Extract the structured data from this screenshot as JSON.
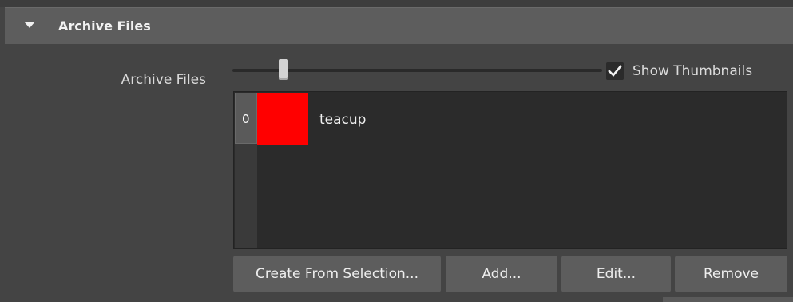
{
  "section": {
    "title": "Archive Files",
    "expanded": true,
    "arrow_icon": "triangle-down-icon"
  },
  "archive_files_row": {
    "label": "Archive Files",
    "thumbnail_size_slider": {
      "value_fraction": 0.13
    },
    "show_thumbnails": {
      "label": "Show Thumbnails",
      "checked": true,
      "icon": "checkmark-icon"
    },
    "list": {
      "items": [
        {
          "index": "0",
          "name": "teacup",
          "thumbnail_color": "#ff0000"
        }
      ]
    }
  },
  "buttons": {
    "create_from_selection": "Create From Selection...",
    "add": "Add...",
    "edit": "Edit...",
    "remove": "Remove"
  },
  "colors": {
    "panel_bg": "#444444",
    "header_bg": "#5d5d5d",
    "list_bg": "#2b2b2b",
    "button_bg": "#5d5d5d"
  }
}
